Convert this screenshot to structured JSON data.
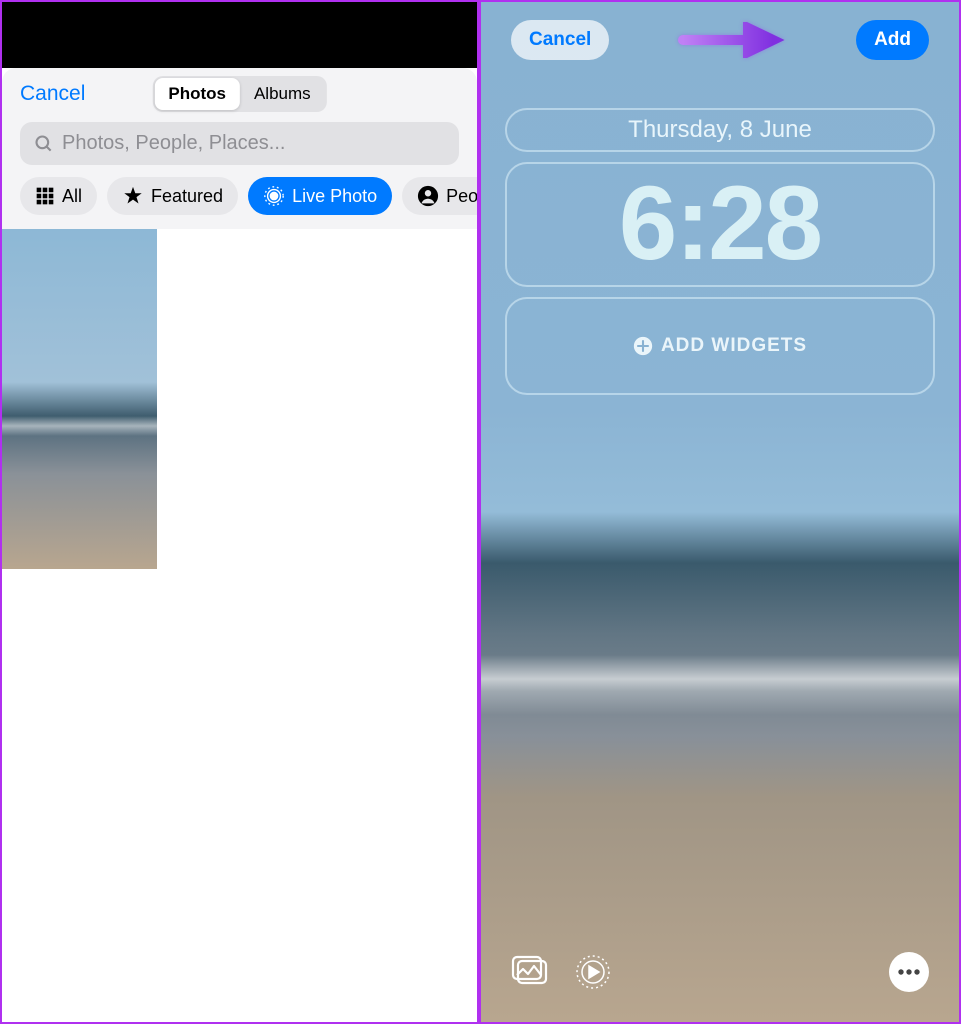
{
  "left": {
    "cancel": "Cancel",
    "segments": {
      "photos": "Photos",
      "albums": "Albums"
    },
    "search_placeholder": "Photos, People, Places...",
    "filters": {
      "all": "All",
      "featured": "Featured",
      "live_photo": "Live Photo",
      "people": "People"
    }
  },
  "right": {
    "cancel": "Cancel",
    "add": "Add",
    "date": "Thursday, 8 June",
    "time": "6:28",
    "add_widgets": "ADD WIDGETS"
  },
  "colors": {
    "accent": "#007aff",
    "border": "#b030f0"
  }
}
